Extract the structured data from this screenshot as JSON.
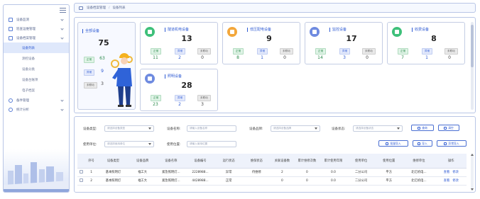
{
  "breadcrumb": {
    "parent": "设备档案管理",
    "current": "设备列表"
  },
  "sidebar": {
    "items": [
      {
        "label": "设备监测",
        "icon": "monitor-icon"
      },
      {
        "label": "巡查运维管理",
        "icon": "inspection-icon"
      },
      {
        "label": "设备档案管理",
        "icon": "archive-icon"
      },
      {
        "label": "设备列表",
        "sub": true,
        "active": true
      },
      {
        "label": "测控设备",
        "sub": true
      },
      {
        "label": "设备分类",
        "sub": true
      },
      {
        "label": "设备台账项",
        "sub": true
      },
      {
        "label": "电子档案",
        "sub": true
      },
      {
        "label": "备件管理",
        "icon": "parts-icon"
      },
      {
        "label": "统计分析",
        "icon": "chart-icon"
      }
    ]
  },
  "summary": {
    "total": {
      "title": "全部设备",
      "count": "75",
      "ok_label": "正常",
      "ok": "63",
      "warn_label": "异常",
      "warn": "9",
      "off_label": "未联动",
      "off": "3"
    },
    "categories": [
      {
        "title": "隧道机电设备",
        "count": "13",
        "ok": "11",
        "warn": "2",
        "off": "0",
        "color": "#3ec07a"
      },
      {
        "title": "低压配电设备",
        "count": "9",
        "ok": "8",
        "warn": "1",
        "off": "0",
        "color": "#f3a73b"
      },
      {
        "title": "监控设备",
        "count": "17",
        "ok": "14",
        "warn": "3",
        "off": "0",
        "color": "#6f8be0"
      },
      {
        "title": "收费设备",
        "count": "8",
        "ok": "7",
        "warn": "1",
        "off": "0",
        "color": "#3ec07a"
      },
      {
        "title": "照明设备",
        "count": "28",
        "ok": "23",
        "warn": "2",
        "off": "3",
        "color": "#6f8be0"
      }
    ],
    "labels": {
      "ok": "正常",
      "warn": "异常",
      "off": "未联动"
    }
  },
  "filters": {
    "type": {
      "label": "设备类型:",
      "placeholder": "请选择设备类型"
    },
    "name": {
      "label": "设备名称:",
      "placeholder": "请输入设备名称"
    },
    "brand": {
      "label": "设备品牌:",
      "placeholder": "请选择设备品牌"
    },
    "status": {
      "label": "设备状态:",
      "placeholder": "请选择设备状态"
    },
    "unit": {
      "label": "使用单位:",
      "placeholder": "请选择使用单位"
    },
    "location": {
      "label": "使用位置:",
      "placeholder": "请输入使用位置"
    },
    "buttons": {
      "search": "查询",
      "clear": "清空",
      "batch_import": "批量导入",
      "import": "导入",
      "export": "异常导入"
    }
  },
  "table": {
    "headers": [
      "序号",
      "设备类型",
      "设备品牌",
      "设备名称",
      "设备编号",
      "运行状态",
      "维保状态",
      "关联设备数",
      "累计维修次数",
      "累计使用年限",
      "使用单位",
      "使用位置",
      "维修单位",
      "操作"
    ],
    "rows": [
      {
        "no": "1",
        "type": "基本照明灯",
        "brand": "福工大",
        "name": "紧急照明灯...",
        "code": "2228988...",
        "run": "异常",
        "maint": "待维修",
        "rel": "2",
        "repairs": "0",
        "years": "0.0",
        "unit": "二分公司",
        "loc": "平方",
        "repair_unit": "北亿机电...",
        "op_view": "查看",
        "op_edit": "修改"
      },
      {
        "no": "2",
        "type": "基本照明灯",
        "brand": "福工大",
        "name": "紧急照明灯...",
        "code": "4428988...",
        "run": "正常",
        "maint": "",
        "rel": "0",
        "repairs": "0",
        "years": "0.0",
        "unit": "二分公司",
        "loc": "平方",
        "repair_unit": "北亿机电...",
        "op_view": "查看",
        "op_edit": "修改"
      }
    ]
  }
}
